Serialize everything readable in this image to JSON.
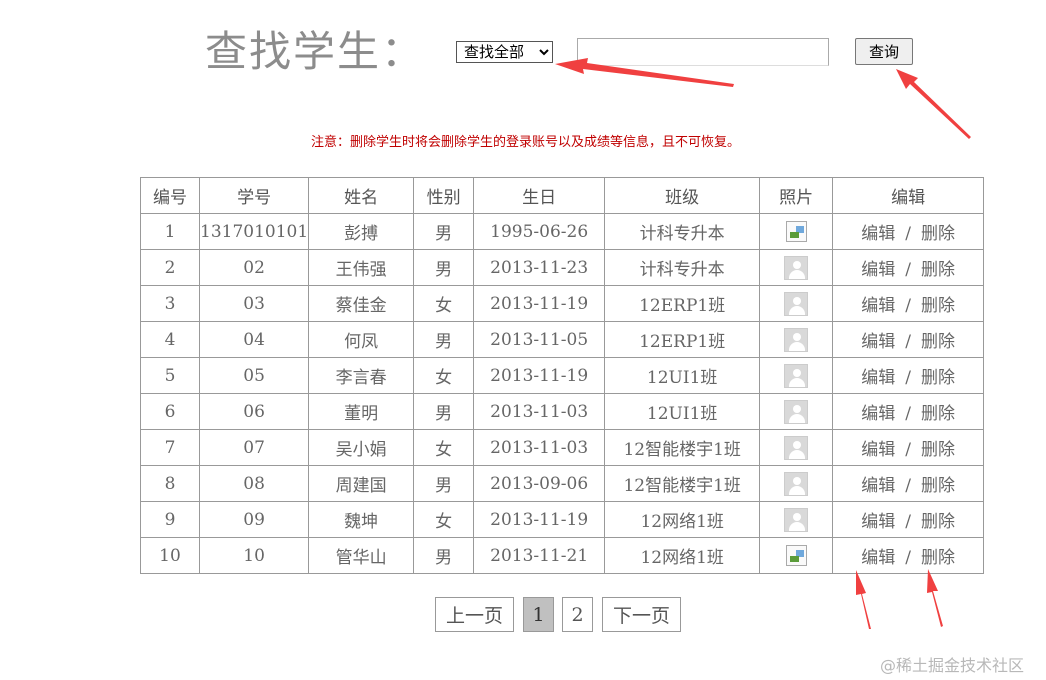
{
  "search": {
    "title": "查找学生：",
    "scope_selected": "查找全部",
    "query_value": "",
    "button_label": "查询"
  },
  "warning_text": "注意：删除学生时将会删除学生的登录账号以及成绩等信息，且不可恢复。",
  "table": {
    "headers": [
      "编号",
      "学号",
      "姓名",
      "性别",
      "生日",
      "班级",
      "照片",
      "编辑"
    ],
    "rows": [
      {
        "no": "1",
        "sid": "1317010101",
        "name": "彭搏",
        "gender": "男",
        "birthday": "1995-06-26",
        "class": "计科专升本",
        "photo": "broken-image"
      },
      {
        "no": "2",
        "sid": "02",
        "name": "王伟强",
        "gender": "男",
        "birthday": "2013-11-23",
        "class": "计科专升本",
        "photo": "avatar-placeholder"
      },
      {
        "no": "3",
        "sid": "03",
        "name": "蔡佳金",
        "gender": "女",
        "birthday": "2013-11-19",
        "class": "12ERP1班",
        "photo": "avatar-placeholder"
      },
      {
        "no": "4",
        "sid": "04",
        "name": "何凤",
        "gender": "男",
        "birthday": "2013-11-05",
        "class": "12ERP1班",
        "photo": "avatar-placeholder"
      },
      {
        "no": "5",
        "sid": "05",
        "name": "李言春",
        "gender": "女",
        "birthday": "2013-11-19",
        "class": "12UI1班",
        "photo": "avatar-placeholder"
      },
      {
        "no": "6",
        "sid": "06",
        "name": "董明",
        "gender": "男",
        "birthday": "2013-11-03",
        "class": "12UI1班",
        "photo": "avatar-placeholder"
      },
      {
        "no": "7",
        "sid": "07",
        "name": "吴小娟",
        "gender": "女",
        "birthday": "2013-11-03",
        "class": "12智能楼宇1班",
        "photo": "avatar-placeholder"
      },
      {
        "no": "8",
        "sid": "08",
        "name": "周建国",
        "gender": "男",
        "birthday": "2013-09-06",
        "class": "12智能楼宇1班",
        "photo": "avatar-placeholder"
      },
      {
        "no": "9",
        "sid": "09",
        "name": "魏坤",
        "gender": "女",
        "birthday": "2013-11-19",
        "class": "12网络1班",
        "photo": "avatar-placeholder"
      },
      {
        "no": "10",
        "sid": "10",
        "name": "管华山",
        "gender": "男",
        "birthday": "2013-11-21",
        "class": "12网络1班",
        "photo": "broken-image"
      }
    ],
    "edit_label": "编辑",
    "action_separator": "/",
    "delete_label": "删除"
  },
  "pagination": {
    "prev_label": "上一页",
    "pages": [
      "1",
      "2"
    ],
    "current_page": "1",
    "next_label": "下一页"
  },
  "watermark": "@稀土掘金技术社区",
  "colors": {
    "warning": "#c00000",
    "annotation_arrow": "#f04040",
    "current_page_bg": "#c0c0c0"
  }
}
